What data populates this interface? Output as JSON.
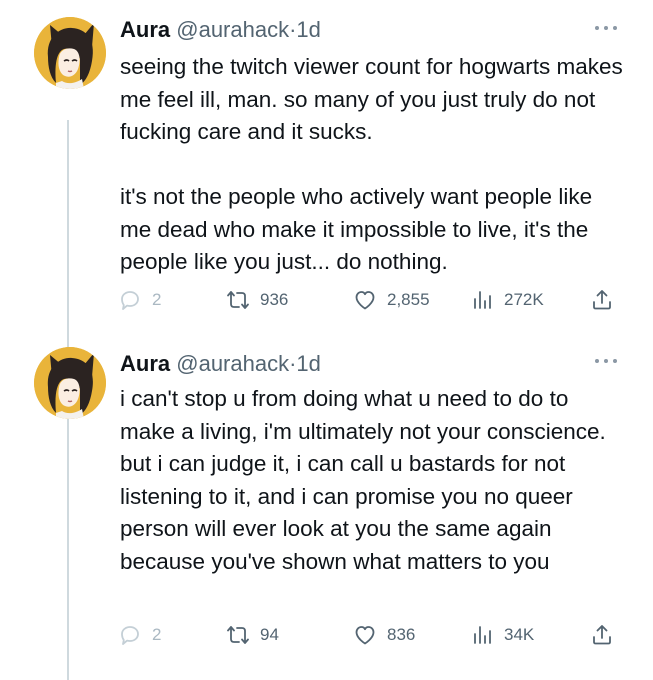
{
  "tweets": [
    {
      "author": {
        "name": "Aura",
        "handle": "@aurahack",
        "time": "1d"
      },
      "text": "seeing the twitch viewer count for hogwarts makes me feel ill, man. so many of you just truly do not fucking care and it sucks.\n\nit's not the people who actively want people like me dead who make it impossible to live, it's the people like you just... do nothing.",
      "stats": {
        "replies": "2",
        "retweets": "936",
        "likes": "2,855",
        "views": "272K"
      }
    },
    {
      "author": {
        "name": "Aura",
        "handle": "@aurahack",
        "time": "1d"
      },
      "text": "i can't stop u from doing what u need to do to make a living, i'm ultimately not your conscience. but i can judge it, i can call u bastards for not listening to it, and i can promise you no queer person will ever look at you the same again because you've shown what matters to you",
      "stats": {
        "replies": "2",
        "retweets": "94",
        "likes": "836",
        "views": "34K"
      }
    }
  ],
  "icons": {
    "more": "more-icon",
    "reply": "reply-icon",
    "retweet": "retweet-icon",
    "like": "heart-icon",
    "views": "views-icon",
    "share": "share-icon"
  },
  "colors": {
    "text": "#0f1419",
    "secondary": "#536471",
    "thread_line": "#cfd9de",
    "avatar_bg": "#e7b63c"
  },
  "separator": "·"
}
